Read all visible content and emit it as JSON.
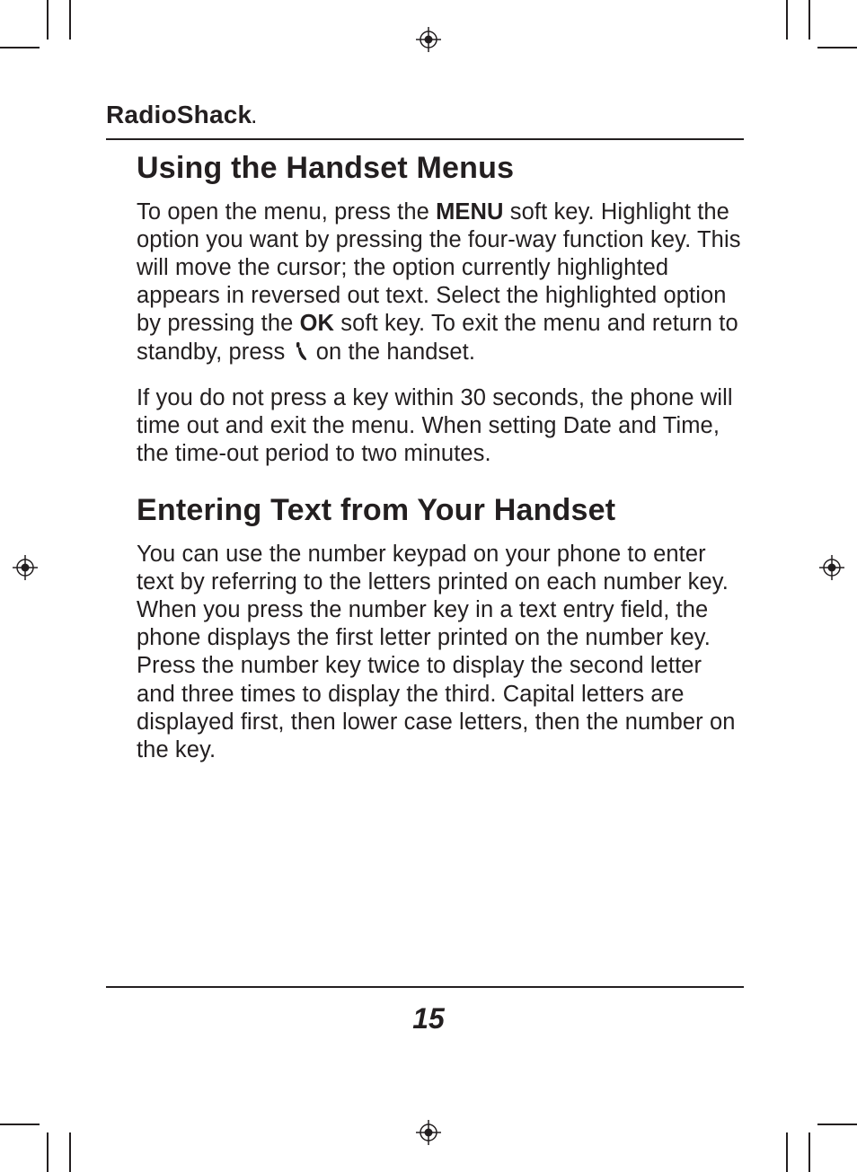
{
  "brand": "RadioShack",
  "page_number": "15",
  "sections": {
    "s1": {
      "title": "Using the Handset Menus",
      "p1_a": "To open the menu, press the ",
      "p1_menu": "MENU",
      "p1_b": " soft key. Highlight the option you want by pressing the four-way function key. This will move the cursor; the option currently highlighted appears in reversed out text. Select the highlighted option by pressing the ",
      "p1_ok": "OK",
      "p1_c": " soft key. To exit the menu and return to standby, press ",
      "p1_d": " on the handset.",
      "p2": "If you do not press a key within 30 seconds, the phone will time out and exit the menu. When setting Date and Time, the time-out period to two minutes."
    },
    "s2": {
      "title": "Entering Text from Your Handset",
      "p1": "You can use the number keypad on your phone to enter text by referring to the letters printed on each number key. When you press the number key in a text entry field, the phone displays the first letter printed on the number key. Press the number key twice to display the second letter and three times to display the third. Capital letters are displayed first, then lower case letters, then the number on the key."
    }
  }
}
